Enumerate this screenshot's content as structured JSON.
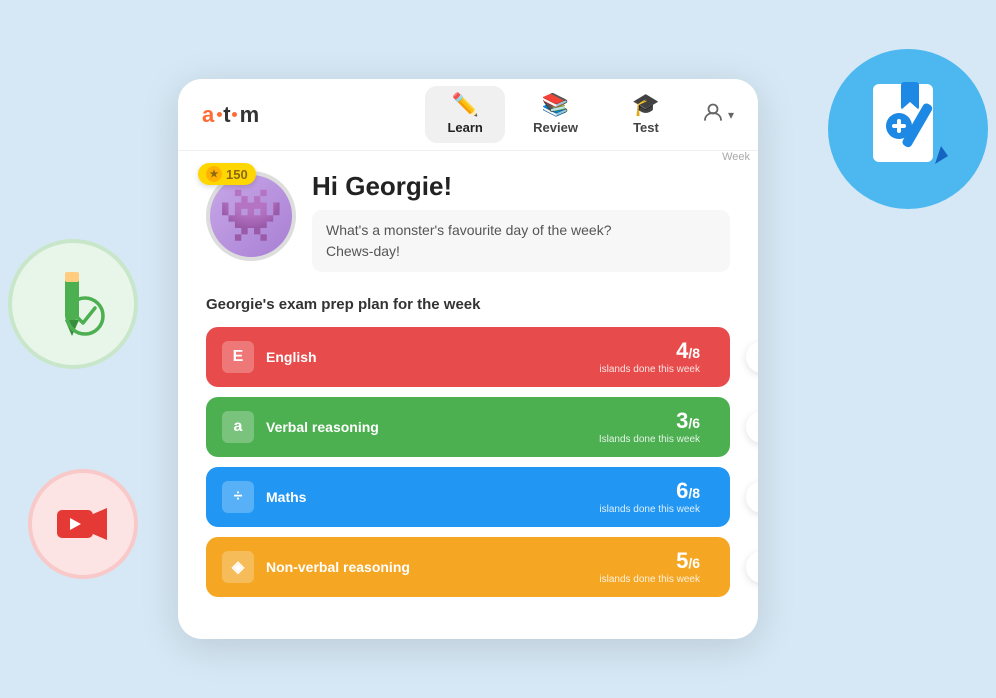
{
  "app": {
    "logo": "Atom",
    "logo_parts": [
      "A",
      "t",
      "o",
      "m"
    ]
  },
  "nav": {
    "tabs": [
      {
        "id": "learn",
        "label": "Learn",
        "icon": "✏️",
        "active": true
      },
      {
        "id": "review",
        "label": "Review",
        "icon": "📚",
        "active": false
      },
      {
        "id": "test",
        "label": "Test",
        "icon": "🎓",
        "active": false
      }
    ],
    "user_icon": "👤",
    "chevron": "▾"
  },
  "hero": {
    "coin_value": "150",
    "greeting": "Hi Georgie!",
    "joke_line1": "What's a monster's favourite day of the week?",
    "joke_line2": "Chews-day!",
    "week_plan_label": "Georgie's exam prep plan for the week"
  },
  "subjects": [
    {
      "id": "english",
      "name": "English",
      "icon": "E",
      "done": "4",
      "total": "8",
      "label": "islands done this week",
      "color_class": "card-english"
    },
    {
      "id": "verbal",
      "name": "Verbal reasoning",
      "icon": "a",
      "done": "3",
      "total": "6",
      "label": "Islands done this week",
      "color_class": "card-verbal"
    },
    {
      "id": "maths",
      "name": "Maths",
      "icon": "÷",
      "done": "6",
      "total": "8",
      "label": "islands done this week",
      "color_class": "card-maths"
    },
    {
      "id": "nonverbal",
      "name": "Non-verbal reasoning",
      "icon": "◈",
      "done": "5",
      "total": "6",
      "label": "islands done this week",
      "color_class": "card-nonverbal"
    }
  ],
  "week_label": "Week",
  "decorations": {
    "notebook_label": "notebook",
    "pencil_check_label": "pencil-check",
    "video_label": "video-camera"
  }
}
